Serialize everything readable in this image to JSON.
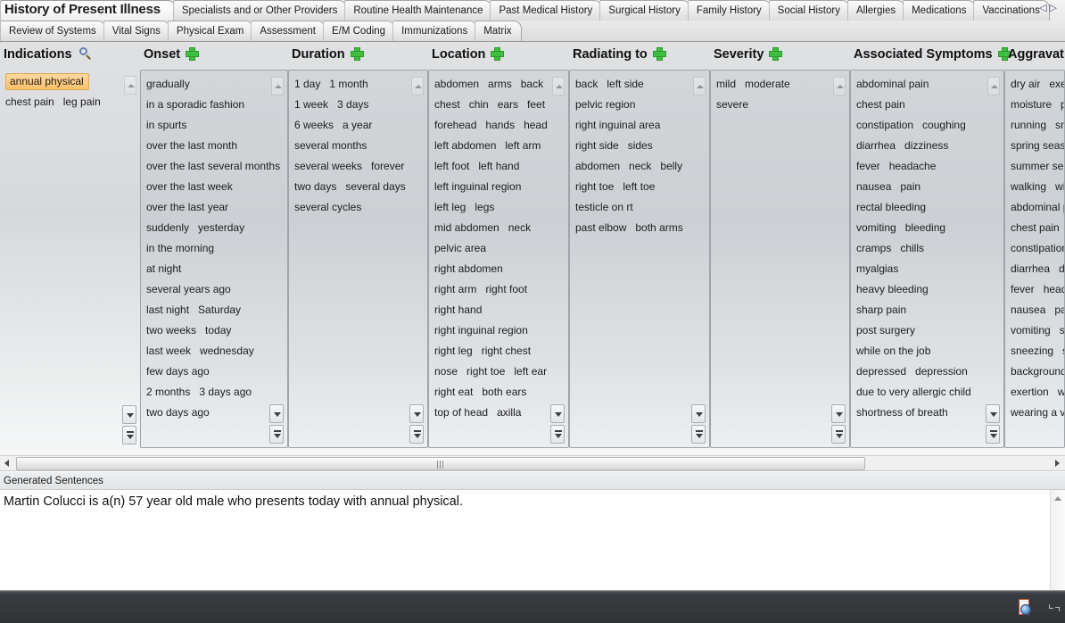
{
  "tabs": {
    "row1": [
      {
        "label": "History of Present Illness",
        "active": true
      },
      {
        "label": "Specialists and or Other Providers",
        "active": false
      },
      {
        "label": "Routine Health Maintenance",
        "active": false
      },
      {
        "label": "Past Medical History",
        "active": false
      },
      {
        "label": "Surgical History",
        "active": false
      },
      {
        "label": "Family History",
        "active": false
      },
      {
        "label": "Social History",
        "active": false
      },
      {
        "label": "Allergies",
        "active": false
      },
      {
        "label": "Medications",
        "active": false
      },
      {
        "label": "Vaccinations",
        "active": false
      }
    ],
    "row2": [
      {
        "label": "Review of Systems",
        "active": false
      },
      {
        "label": "Vital Signs",
        "active": false
      },
      {
        "label": "Physical Exam",
        "active": false
      },
      {
        "label": "Assessment",
        "active": false
      },
      {
        "label": "E/M Coding",
        "active": false
      },
      {
        "label": "Immunizations",
        "active": false
      },
      {
        "label": "Matrix",
        "active": false
      }
    ],
    "nav_prev": "◁",
    "nav_next": "▷"
  },
  "columns": [
    {
      "title": "Indications",
      "icon": "search-icon",
      "items": [
        {
          "words": [
            "annual physical"
          ],
          "selected": true
        },
        {
          "words": [
            "chest pain",
            "leg pain"
          ],
          "selected": false
        }
      ]
    },
    {
      "title": "Onset",
      "icon": "plus-icon",
      "items": [
        {
          "words": [
            "gradually"
          ],
          "selected": false
        },
        {
          "words": [
            "in a sporadic fashion"
          ],
          "selected": false
        },
        {
          "words": [
            "in spurts"
          ],
          "selected": false
        },
        {
          "words": [
            "over the last month"
          ],
          "selected": false
        },
        {
          "words": [
            "over the last several months"
          ],
          "selected": false
        },
        {
          "words": [
            "over the last week"
          ],
          "selected": false
        },
        {
          "words": [
            "over the last year"
          ],
          "selected": false
        },
        {
          "words": [
            "suddenly",
            "yesterday"
          ],
          "selected": false
        },
        {
          "words": [
            "in the morning"
          ],
          "selected": false
        },
        {
          "words": [
            "at night"
          ],
          "selected": false
        },
        {
          "words": [
            "several years ago"
          ],
          "selected": false
        },
        {
          "words": [
            "last night",
            "Saturday"
          ],
          "selected": false
        },
        {
          "words": [
            "two weeks",
            "today"
          ],
          "selected": false
        },
        {
          "words": [
            "last week",
            "wednesday"
          ],
          "selected": false
        },
        {
          "words": [
            "few days ago"
          ],
          "selected": false
        },
        {
          "words": [
            "2 months",
            "3 days ago"
          ],
          "selected": false
        },
        {
          "words": [
            "two days ago"
          ],
          "selected": false
        }
      ]
    },
    {
      "title": "Duration",
      "icon": "plus-icon",
      "items": [
        {
          "words": [
            "1 day",
            "1 month"
          ],
          "selected": false
        },
        {
          "words": [
            "1 week",
            "3 days"
          ],
          "selected": false
        },
        {
          "words": [
            "6 weeks",
            "a year"
          ],
          "selected": false
        },
        {
          "words": [
            "several months"
          ],
          "selected": false
        },
        {
          "words": [
            "several weeks",
            "forever"
          ],
          "selected": false
        },
        {
          "words": [
            "two days",
            "several days"
          ],
          "selected": false
        },
        {
          "words": [
            "several cycles"
          ],
          "selected": false
        }
      ]
    },
    {
      "title": "Location",
      "icon": "plus-icon",
      "items": [
        {
          "words": [
            "abdomen",
            "arms",
            "back"
          ],
          "selected": false
        },
        {
          "words": [
            "chest",
            "chin",
            "ears",
            "feet"
          ],
          "selected": false
        },
        {
          "words": [
            "forehead",
            "hands",
            "head"
          ],
          "selected": false
        },
        {
          "words": [
            "left abdomen",
            "left arm"
          ],
          "selected": false
        },
        {
          "words": [
            "left foot",
            "left hand"
          ],
          "selected": false
        },
        {
          "words": [
            "left inguinal region"
          ],
          "selected": false
        },
        {
          "words": [
            "left leg",
            "legs"
          ],
          "selected": false
        },
        {
          "words": [
            "mid abdomen",
            "neck"
          ],
          "selected": false
        },
        {
          "words": [
            "pelvic area"
          ],
          "selected": false
        },
        {
          "words": [
            "right abdomen"
          ],
          "selected": false
        },
        {
          "words": [
            "right arm",
            "right foot"
          ],
          "selected": false
        },
        {
          "words": [
            "right hand"
          ],
          "selected": false
        },
        {
          "words": [
            "right inguinal region"
          ],
          "selected": false
        },
        {
          "words": [
            "right leg",
            "right chest"
          ],
          "selected": false
        },
        {
          "words": [
            "nose",
            "right toe",
            "left ear"
          ],
          "selected": false
        },
        {
          "words": [
            "right eat",
            "both ears"
          ],
          "selected": false
        },
        {
          "words": [
            "top of head",
            "axilla"
          ],
          "selected": false
        }
      ]
    },
    {
      "title": "Radiating to",
      "icon": "plus-icon",
      "items": [
        {
          "words": [
            "back",
            "left side"
          ],
          "selected": false
        },
        {
          "words": [
            "pelvic region"
          ],
          "selected": false
        },
        {
          "words": [
            "right inguinal area"
          ],
          "selected": false
        },
        {
          "words": [
            "right side",
            "sides"
          ],
          "selected": false
        },
        {
          "words": [
            "abdomen",
            "neck",
            "belly"
          ],
          "selected": false
        },
        {
          "words": [
            "right toe",
            "left toe"
          ],
          "selected": false
        },
        {
          "words": [
            "testicle on rt"
          ],
          "selected": false
        },
        {
          "words": [
            "past elbow",
            "both arms"
          ],
          "selected": false
        }
      ]
    },
    {
      "title": "Severity",
      "icon": "plus-icon",
      "items": [
        {
          "words": [
            "mild",
            "moderate"
          ],
          "selected": false
        },
        {
          "words": [
            "severe"
          ],
          "selected": false
        }
      ]
    },
    {
      "title": "Associated Symptoms",
      "icon": "plus-icon",
      "items": [
        {
          "words": [
            "abdominal pain"
          ],
          "selected": false
        },
        {
          "words": [
            "chest pain"
          ],
          "selected": false
        },
        {
          "words": [
            "constipation",
            "coughing"
          ],
          "selected": false
        },
        {
          "words": [
            "diarrhea",
            "dizziness"
          ],
          "selected": false
        },
        {
          "words": [
            "fever",
            "headache"
          ],
          "selected": false
        },
        {
          "words": [
            "nausea",
            "pain"
          ],
          "selected": false
        },
        {
          "words": [
            "rectal bleeding"
          ],
          "selected": false
        },
        {
          "words": [
            "vomiting",
            "bleeding"
          ],
          "selected": false
        },
        {
          "words": [
            "cramps",
            "chills"
          ],
          "selected": false
        },
        {
          "words": [
            "myalgias"
          ],
          "selected": false
        },
        {
          "words": [
            "heavy bleeding"
          ],
          "selected": false
        },
        {
          "words": [
            "sharp pain"
          ],
          "selected": false
        },
        {
          "words": [
            "post surgery"
          ],
          "selected": false
        },
        {
          "words": [
            "while on the job"
          ],
          "selected": false
        },
        {
          "words": [
            "depressed",
            "depression"
          ],
          "selected": false
        },
        {
          "words": [
            "due to very allergic child"
          ],
          "selected": false
        },
        {
          "words": [
            "shortness of breath"
          ],
          "selected": false
        }
      ]
    },
    {
      "title": "Aggravat",
      "icon": "none",
      "items": [
        {
          "words": [
            "dry air",
            "exe"
          ],
          "selected": false
        },
        {
          "words": [
            "moisture",
            "p"
          ],
          "selected": false
        },
        {
          "words": [
            "running",
            "sn"
          ],
          "selected": false
        },
        {
          "words": [
            "spring seas"
          ],
          "selected": false
        },
        {
          "words": [
            "summer se"
          ],
          "selected": false
        },
        {
          "words": [
            "walking",
            "wi"
          ],
          "selected": false
        },
        {
          "words": [
            "abdominal p"
          ],
          "selected": false
        },
        {
          "words": [
            "chest pain"
          ],
          "selected": false
        },
        {
          "words": [
            "constipation"
          ],
          "selected": false
        },
        {
          "words": [
            "diarrhea",
            "di"
          ],
          "selected": false
        },
        {
          "words": [
            "fever",
            "head"
          ],
          "selected": false
        },
        {
          "words": [
            "nausea",
            "pa"
          ],
          "selected": false
        },
        {
          "words": [
            "vomiting",
            "s"
          ],
          "selected": false
        },
        {
          "words": [
            "sneezing",
            "s"
          ],
          "selected": false
        },
        {
          "words": [
            "background"
          ],
          "selected": false
        },
        {
          "words": [
            "exertion",
            "w"
          ],
          "selected": false
        },
        {
          "words": [
            "wearing a v"
          ],
          "selected": false
        }
      ]
    }
  ],
  "generated": {
    "label": "Generated Sentences",
    "text": "Martin Colucci is a(n) 57 year old male who presents today with annual physical."
  }
}
